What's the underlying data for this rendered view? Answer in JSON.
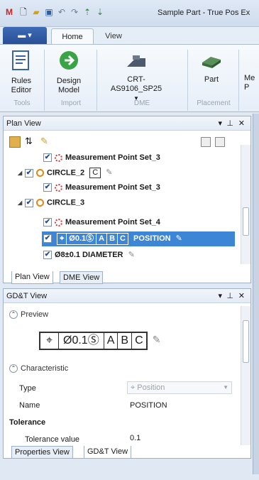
{
  "titlebar": {
    "title": "Sample Part - True Pos Ex",
    "icons": [
      "app-logo-icon",
      "new-file-icon",
      "open-folder-icon",
      "save-icon",
      "undo-icon",
      "redo-icon",
      "sort-up-icon",
      "sort-down-icon"
    ]
  },
  "ribbon": {
    "file_label": "",
    "tabs": [
      "Home",
      "View"
    ],
    "buttons": {
      "rules_editor": "Rules Editor",
      "design_model": "Design Model",
      "dme_value": "CRT-AS9106_SP25",
      "part": "Part",
      "more": "Me P"
    },
    "groups": {
      "tools": "Tools",
      "import": "Import",
      "dme": "DME",
      "placement": "Placement"
    }
  },
  "plan_view": {
    "title": "Plan View",
    "rows": [
      {
        "label": "Measurement Point Set_3"
      },
      {
        "label": "CIRCLE_2",
        "badge": "C"
      },
      {
        "label": "Measurement Point Set_3"
      },
      {
        "label": "CIRCLE_3"
      },
      {
        "label": "Measurement Point Set_4"
      },
      {
        "fcf": [
          "⌖",
          "Ø0.1Ⓢ",
          "A",
          "B",
          "C"
        ],
        "label": "POSITION"
      },
      {
        "label": "Ø8±0.1 DIAMETER"
      }
    ],
    "tabs": [
      "Plan View",
      "DME View"
    ]
  },
  "gdt_view": {
    "title": "GD&T View",
    "preview_label": "Preview",
    "preview_fcf": [
      "⌖",
      "Ø0.1Ⓢ",
      "A",
      "B",
      "C"
    ],
    "characteristic_label": "Characteristic",
    "type_label": "Type",
    "type_value": "Position",
    "name_label": "Name",
    "name_value": "POSITION",
    "tolerance_header": "Tolerance",
    "tolerance_value_label": "Tolerance value",
    "tolerance_value": "0.1",
    "tabs": [
      "Properties View",
      "GD&T View"
    ]
  }
}
